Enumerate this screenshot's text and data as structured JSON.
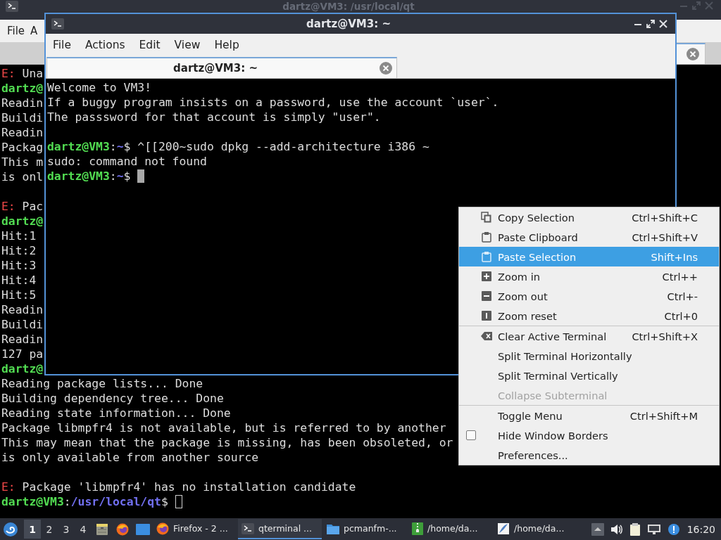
{
  "background_window": {
    "title": "dartz@VM3: /usr/local/qt",
    "active": false,
    "menu": [
      "File",
      "A"
    ],
    "terminal": {
      "focused": false,
      "blocks": [
        {
          "lines": [
            {
              "segments": [
                {
                  "kind": "error",
                  "text": "E:"
                },
                {
                  "kind": "text",
                  "text": " Una"
                }
              ]
            },
            {
              "segments": [
                {
                  "kind": "user",
                  "text": "dartz@"
                }
              ]
            },
            {
              "segments": [
                {
                  "kind": "text",
                  "text": "Readin"
                }
              ]
            },
            {
              "segments": [
                {
                  "kind": "text",
                  "text": "Buildi"
                }
              ]
            },
            {
              "segments": [
                {
                  "kind": "text",
                  "text": "Readin"
                }
              ]
            },
            {
              "segments": [
                {
                  "kind": "text",
                  "text": "Packag"
                }
              ]
            },
            {
              "segments": [
                {
                  "kind": "text",
                  "text": "This m"
                }
              ]
            },
            {
              "segments": [
                {
                  "kind": "text",
                  "text": "is onl"
                }
              ]
            }
          ]
        },
        {
          "lines": [
            {
              "segments": [
                {
                  "kind": "error",
                  "text": "E:"
                },
                {
                  "kind": "text",
                  "text": " Pac"
                }
              ]
            },
            {
              "segments": [
                {
                  "kind": "user",
                  "text": "dartz@"
                }
              ]
            },
            {
              "segments": [
                {
                  "kind": "text",
                  "text": "Hit:1"
                }
              ]
            },
            {
              "segments": [
                {
                  "kind": "text",
                  "text": "Hit:2"
                }
              ]
            },
            {
              "segments": [
                {
                  "kind": "text",
                  "text": "Hit:3"
                }
              ]
            },
            {
              "segments": [
                {
                  "kind": "text",
                  "text": "Hit:4"
                }
              ]
            },
            {
              "segments": [
                {
                  "kind": "text",
                  "text": "Hit:5"
                }
              ]
            },
            {
              "segments": [
                {
                  "kind": "text",
                  "text": "Readin"
                }
              ]
            },
            {
              "segments": [
                {
                  "kind": "text",
                  "text": "Buildi"
                }
              ]
            },
            {
              "segments": [
                {
                  "kind": "text",
                  "text": "Readin"
                }
              ]
            },
            {
              "segments": [
                {
                  "kind": "text",
                  "text": "127 pa"
                }
              ]
            },
            {
              "segments": [
                {
                  "kind": "user",
                  "text": "dartz@"
                }
              ]
            },
            {
              "segments": [
                {
                  "kind": "text",
                  "text": "Reading package lists... Done"
                }
              ]
            },
            {
              "segments": [
                {
                  "kind": "text",
                  "text": "Building dependency tree... Done"
                }
              ]
            },
            {
              "segments": [
                {
                  "kind": "text",
                  "text": "Reading state information... Done"
                }
              ]
            },
            {
              "segments": [
                {
                  "kind": "text",
                  "text": "Package libmpfr4 is not available, but is referred to by another"
                }
              ]
            },
            {
              "segments": [
                {
                  "kind": "text",
                  "text": "This may mean that the package is missing, has been obsoleted, or"
                }
              ]
            },
            {
              "segments": [
                {
                  "kind": "text",
                  "text": "is only available from another source"
                }
              ]
            }
          ]
        },
        {
          "lines": [
            {
              "segments": [
                {
                  "kind": "error",
                  "text": "E:"
                },
                {
                  "kind": "text",
                  "text": " Package 'libmpfr4' has no installation candidate"
                }
              ]
            },
            {
              "segments": [
                {
                  "kind": "user",
                  "text": "dartz@VM3"
                },
                {
                  "kind": "text",
                  "text": ":"
                },
                {
                  "kind": "path",
                  "text": "/usr/local/qt"
                },
                {
                  "kind": "text",
                  "text": "$"
                }
              ]
            }
          ]
        }
      ]
    }
  },
  "front_window": {
    "title": "dartz@VM3: ~",
    "active": true,
    "menu": [
      "File",
      "Actions",
      "Edit",
      "View",
      "Help"
    ],
    "tabs": [
      {
        "label": "dartz@VM3: ~",
        "selected": true
      }
    ],
    "terminal": {
      "focused": true,
      "blocks": [
        {
          "lines": [
            {
              "segments": [
                {
                  "kind": "text",
                  "text": "Welcome to VM3!"
                }
              ]
            },
            {
              "segments": [
                {
                  "kind": "text",
                  "text": "If a buggy program insists on a password, use the account `user`."
                }
              ]
            },
            {
              "segments": [
                {
                  "kind": "text",
                  "text": "The passsword for that account is simply \"user\"."
                }
              ]
            }
          ]
        },
        {
          "lines": [
            {
              "segments": [
                {
                  "kind": "user",
                  "text": "dartz@VM3"
                },
                {
                  "kind": "text",
                  "text": ":"
                },
                {
                  "kind": "path",
                  "text": "~"
                },
                {
                  "kind": "text",
                  "text": "$ ^[[200~sudo dpkg --add-architecture i386 ~"
                }
              ]
            },
            {
              "segments": [
                {
                  "kind": "text",
                  "text": "sudo: command not found"
                }
              ]
            },
            {
              "segments": [
                {
                  "kind": "user",
                  "text": "dartz@VM3"
                },
                {
                  "kind": "text",
                  "text": ":"
                },
                {
                  "kind": "path",
                  "text": "~"
                },
                {
                  "kind": "text",
                  "text": "$"
                }
              ]
            }
          ]
        }
      ]
    }
  },
  "context_menu": {
    "sections": [
      {
        "items": [
          {
            "kind": "action",
            "label": "Copy Selection",
            "shortcut": "Ctrl+Shift+C",
            "selected": false,
            "disabled": false
          },
          {
            "kind": "action",
            "label": "Paste Clipboard",
            "shortcut": "Ctrl+Shift+V",
            "selected": false,
            "disabled": false
          },
          {
            "kind": "action",
            "label": "Paste Selection",
            "shortcut": "Shift+Ins",
            "selected": true,
            "disabled": false
          },
          {
            "kind": "action",
            "label": "Zoom in",
            "shortcut": "Ctrl++",
            "selected": false,
            "disabled": false
          },
          {
            "kind": "action",
            "label": "Zoom out",
            "shortcut": "Ctrl+-",
            "selected": false,
            "disabled": false
          },
          {
            "kind": "action",
            "label": "Zoom reset",
            "shortcut": "Ctrl+0",
            "selected": false,
            "disabled": false
          }
        ]
      },
      {
        "items": [
          {
            "kind": "action",
            "label": "Clear Active Terminal",
            "shortcut": "Ctrl+Shift+X",
            "selected": false,
            "disabled": false
          },
          {
            "kind": "action",
            "label": "Split Terminal Horizontally",
            "selected": false,
            "disabled": false
          },
          {
            "kind": "action",
            "label": "Split Terminal Vertically",
            "selected": false,
            "disabled": false
          },
          {
            "kind": "action",
            "label": "Collapse Subterminal",
            "selected": false,
            "disabled": true
          }
        ]
      },
      {
        "items": [
          {
            "kind": "action",
            "label": "Toggle Menu",
            "shortcut": "Ctrl+Shift+M",
            "selected": false,
            "disabled": false
          },
          {
            "kind": "checkbox",
            "label": "Hide Window Borders",
            "checked": false,
            "selected": false,
            "disabled": false
          },
          {
            "kind": "action",
            "label": "Preferences...",
            "selected": false,
            "disabled": false
          }
        ]
      }
    ]
  },
  "taskbar": {
    "desktops": [
      {
        "label": "1",
        "selected": true
      },
      {
        "label": "2",
        "selected": false
      },
      {
        "label": "3",
        "selected": false
      },
      {
        "label": "4",
        "selected": false
      }
    ],
    "tasks": [
      {
        "label": "Firefox - 2 ...",
        "selected": false
      },
      {
        "label": "qterminal ...",
        "selected": true
      },
      {
        "label": "pcmanfm-...",
        "selected": false
      },
      {
        "label": "/home/da...",
        "selected": false
      },
      {
        "label": "/home/da...",
        "selected": false
      }
    ],
    "clock": "16:20"
  }
}
